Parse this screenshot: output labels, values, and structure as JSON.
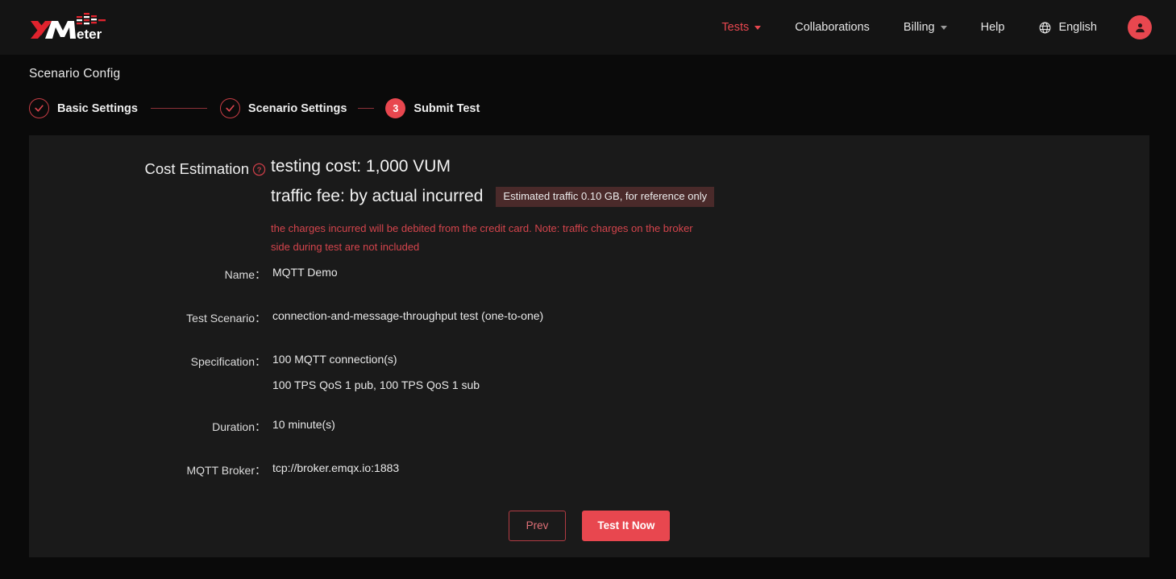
{
  "brand": {
    "logo_text": "XMeter",
    "accent_color": "#e8474f"
  },
  "header": {
    "nav": [
      {
        "label": "Tests",
        "icon": "chevron-down-icon",
        "active": true,
        "has_caret": true
      },
      {
        "label": "Collaborations",
        "active": false,
        "has_caret": false
      },
      {
        "label": "Billing",
        "icon": "chevron-down-icon",
        "active": false,
        "has_caret": true
      },
      {
        "label": "Help",
        "active": false,
        "has_caret": false
      }
    ],
    "language": {
      "label": "English",
      "icon": "globe-icon"
    },
    "avatar": {
      "icon": "user-avatar-icon"
    }
  },
  "page": {
    "title": "Scenario Config"
  },
  "stepper": {
    "steps": [
      {
        "label": "Basic Settings",
        "state": "done",
        "marker": "check-icon"
      },
      {
        "label": "Scenario Settings",
        "state": "done",
        "marker": "check-icon"
      },
      {
        "label": "Submit Test",
        "state": "current",
        "marker": "3"
      }
    ]
  },
  "cost_estimation": {
    "label": "Cost Estimation",
    "help_icon": "question-mark-icon",
    "testing_cost": "testing cost: 1,000 VUM",
    "traffic_fee": "traffic fee: by actual incurred",
    "traffic_badge": "Estimated traffic 0.10 GB, for reference only",
    "note": "the charges incurred will be debited from the credit card. Note: traffic charges on the broker side during test are not included",
    "badge_bg": "#4a2a2a",
    "note_color": "#d4444c"
  },
  "summary": {
    "rows": [
      {
        "label": "Name：",
        "value": "MQTT Demo"
      },
      {
        "label": "Test Scenario：",
        "value": "connection-and-message-throughput test (one-to-one)"
      },
      {
        "label": "Specification：",
        "value": "100 MQTT connection(s)",
        "value2": "100 TPS QoS 1 pub, 100 TPS QoS 1 sub"
      },
      {
        "label": "Duration：",
        "value": "10 minute(s)"
      },
      {
        "label": "MQTT Broker：",
        "value": "tcp://broker.emqx.io:1883"
      }
    ]
  },
  "actions": {
    "prev_label": "Prev",
    "submit_label": "Test It Now"
  }
}
